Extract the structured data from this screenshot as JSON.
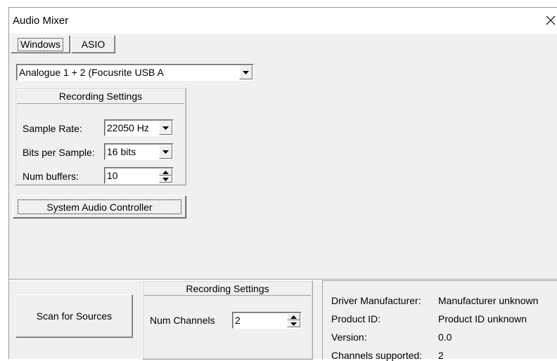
{
  "window": {
    "title": "Audio Mixer"
  },
  "tabs": [
    {
      "label": "Windows",
      "selected": true
    },
    {
      "label": "ASIO",
      "selected": false
    }
  ],
  "device_select": {
    "value": "Analogue 1 + 2 (Focusrite USB A"
  },
  "recording_settings": {
    "header": "Recording Settings",
    "sample_rate": {
      "label": "Sample Rate:",
      "value": "22050 Hz"
    },
    "bits_per_sample": {
      "label": "Bits per Sample:",
      "value": "16 bits"
    },
    "num_buffers": {
      "label": "Num buffers:",
      "value": "10"
    }
  },
  "system_audio_button": {
    "label": "System Audio Controller"
  },
  "scan_button": {
    "label": "Scan for Sources"
  },
  "channel_settings": {
    "header": "Recording Settings",
    "num_channels": {
      "label": "Num Channels",
      "value": "2"
    }
  },
  "driver_info": {
    "rows": [
      {
        "label": "Driver Manufacturer:",
        "value": "Manufacturer unknown"
      },
      {
        "label": "Product ID:",
        "value": "Product ID unknown"
      },
      {
        "label": "Version:",
        "value": "0.0"
      },
      {
        "label": "Channels supported:",
        "value": "2"
      }
    ]
  },
  "icons": {
    "close": "close-icon",
    "dropdown": "chevron-down-icon",
    "spin_up": "spin-up-icon",
    "spin_down": "spin-down-icon"
  }
}
